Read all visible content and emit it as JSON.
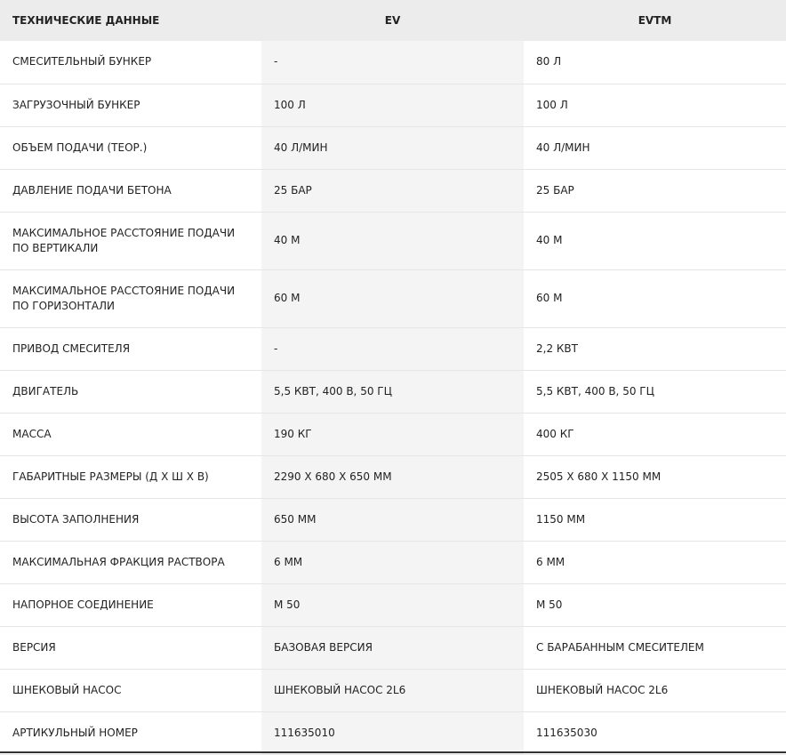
{
  "table": {
    "headers": [
      "ТЕХНИЧЕСКИЕ ДАННЫЕ",
      "EV",
      "EVTM"
    ],
    "rows": [
      [
        "СМЕСИТЕЛЬНЫЙ БУНКЕР",
        "-",
        "80 Л"
      ],
      [
        "ЗАГРУЗОЧНЫЙ БУНКЕР",
        "100 Л",
        "100 Л"
      ],
      [
        "ОБЪЕМ ПОДАЧИ (ТЕОР.)",
        "40 Л/МИН",
        "40 Л/МИН"
      ],
      [
        "ДАВЛЕНИЕ ПОДАЧИ БЕТОНА",
        "25 БАР",
        "25 БАР"
      ],
      [
        "МАКСИМАЛЬНОЕ РАССТОЯНИЕ ПОДАЧИ ПО ВЕРТИКАЛИ",
        "40 М",
        "40 М"
      ],
      [
        "МАКСИМАЛЬНОЕ РАССТОЯНИЕ ПОДАЧИ ПО ГОРИЗОНТАЛИ",
        "60 М",
        "60 М"
      ],
      [
        "ПРИВОД СМЕСИТЕЛЯ",
        "-",
        "2,2 КВТ"
      ],
      [
        "ДВИГАТЕЛЬ",
        "5,5 КВТ, 400 В, 50 ГЦ",
        "5,5 КВТ, 400 В, 50 ГЦ"
      ],
      [
        "МАССА",
        "190 КГ",
        "400 КГ"
      ],
      [
        "ГАБАРИТНЫЕ РАЗМЕРЫ (Д Х Ш Х В)",
        "2290 Х 680 Х 650 ММ",
        "2505 Х 680 Х 1150 ММ"
      ],
      [
        "ВЫСОТА ЗАПОЛНЕНИЯ",
        "650 ММ",
        "1150 ММ"
      ],
      [
        "МАКСИМАЛЬНАЯ ФРАКЦИЯ РАСТВОРА",
        "6 ММ",
        "6 ММ"
      ],
      [
        "НАПОРНОЕ СОЕДИНЕНИЕ",
        "M 50",
        "M 50"
      ],
      [
        "ВЕРСИЯ",
        "БАЗОВАЯ ВЕРСИЯ",
        "С БАРАБАННЫМ СМЕСИТЕЛЕМ"
      ],
      [
        "ШНЕКОВЫЙ НАСОС",
        "ШНЕКОВЫЙ НАСОС 2L6",
        "ШНЕКОВЫЙ НАСОС 2L6"
      ],
      [
        "АРТИКУЛЬНЫЙ НОМЕР",
        "111635010",
        "111635030"
      ]
    ]
  }
}
